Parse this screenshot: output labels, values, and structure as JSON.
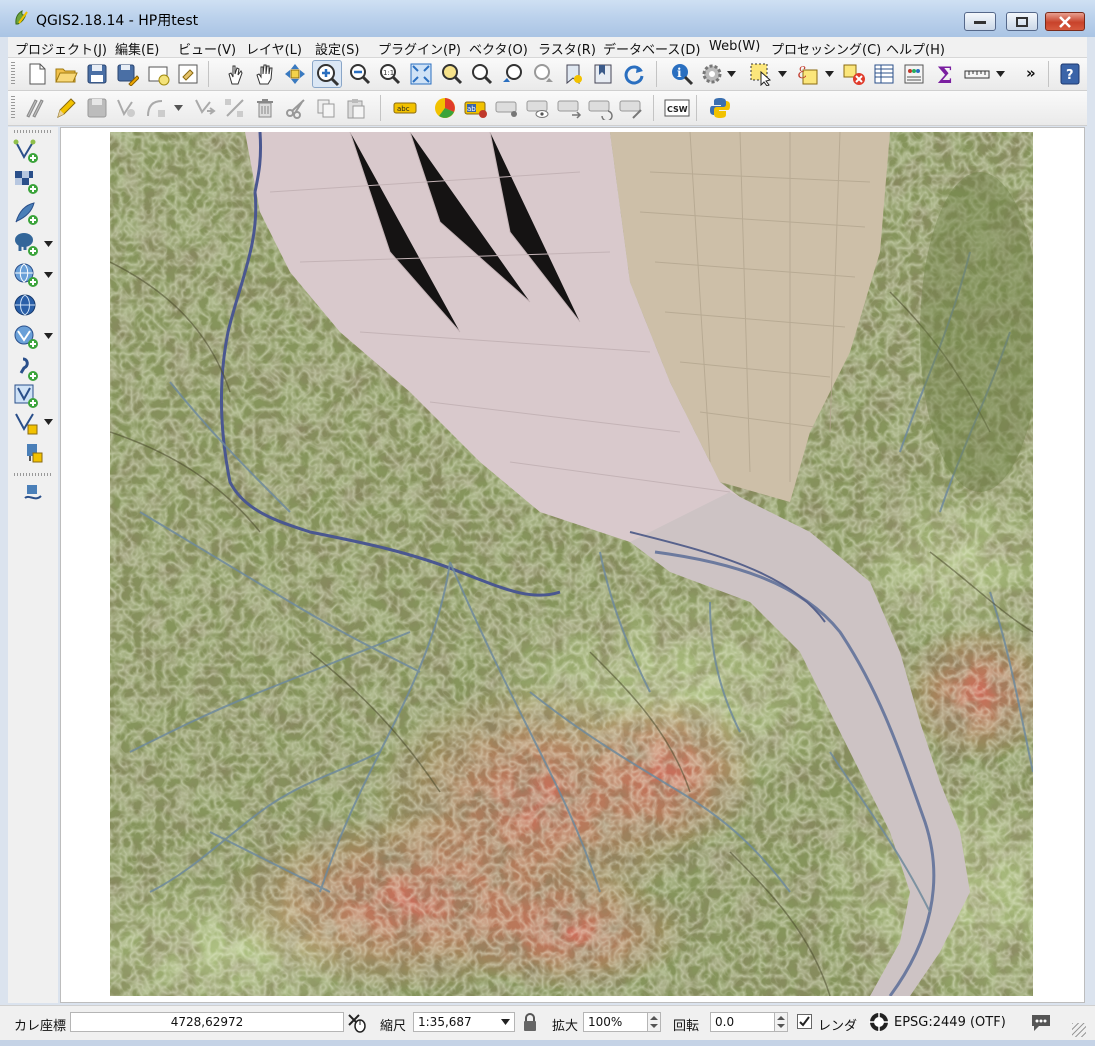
{
  "window": {
    "title": "QGIS2.18.14 - HP用test"
  },
  "menu": [
    "プロジェクト(J)",
    "編集(E)",
    "ビュー(V)",
    "レイヤ(L)",
    "設定(S)",
    "プラグイン(P)",
    "ベクタ(O)",
    "ラスタ(R)",
    "データベース(D)",
    "Web(W)",
    "プロセッシング(C)",
    "ヘルプ(H)"
  ],
  "toolbar": {
    "overflow_label": "»",
    "csw_label": "CSW",
    "label_abc": "abc",
    "label_ab": "ab",
    "sigma_label": "Σ"
  },
  "status": {
    "coord_label": "カレ座標",
    "coord_value": "4728,62972",
    "scale_label": "縮尺",
    "scale_value": "1:35,687",
    "magnifier_label": "拡大",
    "magnifier_value": "100%",
    "rotation_label": "回転",
    "rotation_value": "0.0",
    "render_label": "レンダ",
    "render_checked": true,
    "crs_label": "EPSG:2449 (OTF)"
  },
  "map": {
    "description_colors": {
      "floodplain": "#d9c9cc",
      "terrace": "#cdbfa8",
      "forest_low": "#7a8a4e",
      "forest_mid": "#98a866",
      "ridge_high": "#c96a58",
      "river": "#5a6a9a"
    }
  }
}
